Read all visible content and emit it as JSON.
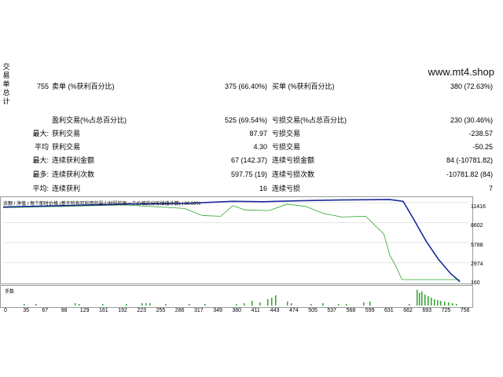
{
  "section_label": [
    "交",
    "易",
    "单",
    "总",
    "计"
  ],
  "site": "www.mt4.shop",
  "rows": [
    {
      "c1_label": "755",
      "c2_label": "卖单 (%获利百分比)",
      "c3_value": "375 (66.40%)",
      "c4_label": "买单 (%获利百分比)",
      "c5_value": "380 (72.63%)"
    },
    {
      "c1_label": "",
      "c2_label": "盈利交易(%占总百分比)",
      "c3_value": "525 (69.54%)",
      "c4_label": "亏损交易(%占总百分比)",
      "c5_value": "230 (30.46%)"
    },
    {
      "c1_label": "最大:",
      "c2_label": "获利交易",
      "c3_value": "87.97",
      "c4_label": "亏损交易",
      "c5_value": "-238.57"
    },
    {
      "c1_label": "平均",
      "c2_label": "获利交易",
      "c3_value": "4.30",
      "c4_label": "亏损交易",
      "c5_value": "-50.25"
    },
    {
      "c1_label": "最大:",
      "c2_label": "连续获利金额",
      "c3_value": "67 (142.37)",
      "c4_label": "连续亏损金额",
      "c5_value": "84 (-10781.82)"
    },
    {
      "c1_label": "最多:",
      "c2_label": "连续获利次数",
      "c3_value": "597.75 (19)",
      "c4_label": "连续亏损次数",
      "c5_value": "-10781.82 (84)"
    },
    {
      "c1_label": "平均:",
      "c2_label": "连续获利",
      "c3_value": "16",
      "c4_label": "连续亏损",
      "c5_value": "7"
    }
  ],
  "chart": {
    "header": "余额 / 净值 / 每个即时价格 (基于所有可利用的最小时段的每一个价格的分形插值计算) | 90.00%",
    "y_ticks": [
      "11416",
      "8602",
      "5788",
      "2974",
      "160"
    ],
    "vol_label": "手数",
    "x_ticks": [
      "0",
      "35",
      "67",
      "98",
      "129",
      "161",
      "192",
      "223",
      "255",
      "286",
      "317",
      "349",
      "380",
      "411",
      "443",
      "474",
      "505",
      "537",
      "568",
      "599",
      "631",
      "662",
      "693",
      "725",
      "756"
    ],
    "colors": {
      "balance": "#1a2a9c",
      "equity": "#2aa52a",
      "volume": "#2aa52a"
    }
  },
  "chart_data": {
    "type": "line",
    "series": [
      {
        "name": "余额",
        "x": [
          0,
          100,
          200,
          300,
          380,
          430,
          500,
          560,
          640,
          662,
          680,
          700,
          720,
          740,
          756
        ],
        "y": [
          10800,
          11000,
          11200,
          11300,
          11600,
          11550,
          11700,
          11800,
          11850,
          11600,
          9000,
          6000,
          3500,
          1500,
          300
        ]
      },
      {
        "name": "净值",
        "x": [
          0,
          100,
          200,
          300,
          330,
          360,
          380,
          400,
          440,
          470,
          500,
          530,
          560,
          600,
          630,
          640,
          650,
          660,
          680,
          700,
          756
        ],
        "y": [
          10700,
          10900,
          11100,
          10600,
          9600,
          9500,
          11000,
          10400,
          10300,
          11200,
          10900,
          9900,
          9400,
          9500,
          7000,
          4000,
          2500,
          600,
          600,
          600,
          600
        ]
      }
    ],
    "ylim": [
      160,
      11416
    ],
    "xlim": [
      0,
      770
    ]
  }
}
